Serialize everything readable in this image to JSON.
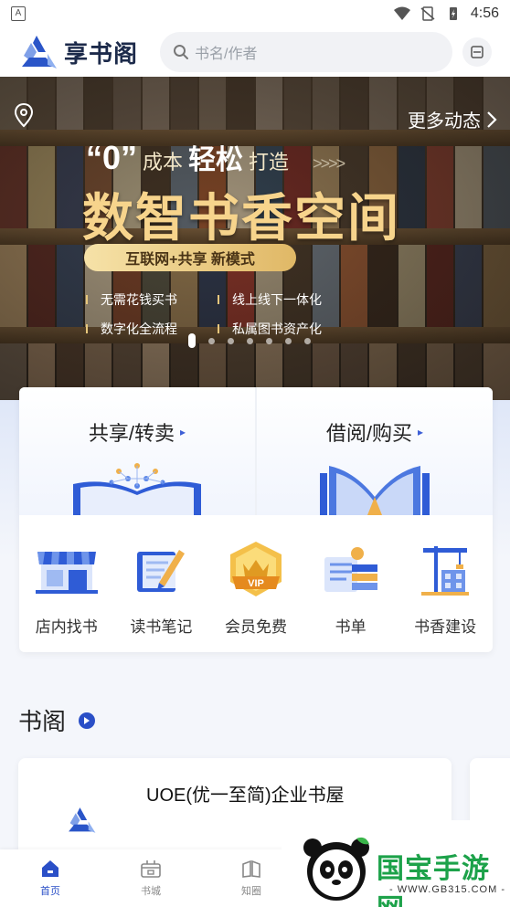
{
  "status_bar": {
    "time": "4:56",
    "sim_label": "A"
  },
  "header": {
    "app_name": "享书阁",
    "search_placeholder": "书名/作者"
  },
  "banner": {
    "more_label": "更多动态",
    "zero": "“0”",
    "cost": "成本",
    "easy": "轻松",
    "build": "打造",
    "arrows": ">>>>",
    "headline": "数智书香空间",
    "pill": "互联网+共享 新模式",
    "features": [
      "无需花钱买书",
      "线上线下一体化",
      "数字化全流程",
      "私属图书资产化"
    ],
    "slide_count": 7,
    "active_slide": 1
  },
  "services": [
    {
      "label": "共享/转卖"
    },
    {
      "label": "借阅/购买"
    }
  ],
  "quick_links": [
    {
      "label": "店内找书",
      "icon": "storefront-icon"
    },
    {
      "label": "读书笔记",
      "icon": "notebook-pen-icon"
    },
    {
      "label": "会员免费",
      "icon": "vip-crown-icon"
    },
    {
      "label": "书单",
      "icon": "scroll-list-icon"
    },
    {
      "label": "书香建设",
      "icon": "crane-building-icon"
    }
  ],
  "section": {
    "title": "书阁"
  },
  "book_house": {
    "name": "UOE(优一至简)企业书屋"
  },
  "tabs": [
    {
      "label": "首页",
      "icon": "home-icon",
      "active": true
    },
    {
      "label": "书城",
      "icon": "bookstore-icon",
      "active": false
    },
    {
      "label": "知圈",
      "icon": "circle-icon",
      "active": false
    }
  ],
  "watermark": {
    "text": "国宝手游网",
    "url": "- WWW.GB315.COM -"
  },
  "colors": {
    "brand_blue": "#2a4fc7",
    "gold": "#f7d48c",
    "watermark_green": "#1da24a"
  }
}
